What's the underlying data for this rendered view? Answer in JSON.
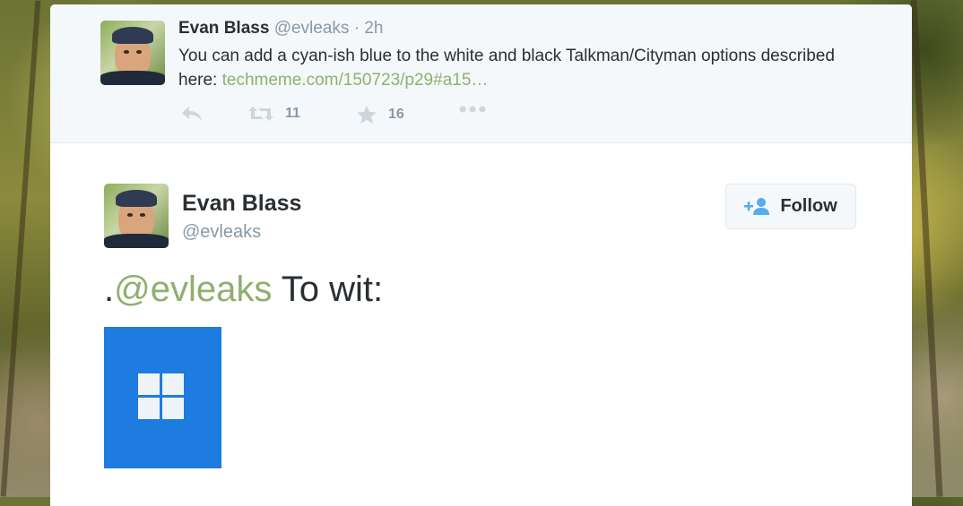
{
  "background": {
    "description_colors": [
      "#6b7434",
      "#c7b84d"
    ]
  },
  "previous_tweet": {
    "author_name": "Evan Blass",
    "author_handle": "@evleaks",
    "timestamp": "· 2h",
    "text_before_link": "You can add a cyan-ish blue to the white and black Talkman/Cityman options described here: ",
    "link_text": "techmeme.com/150723/p29#a15…",
    "actions": {
      "reply_icon": "reply-icon",
      "retweet_icon": "retweet-icon",
      "retweet_count": "11",
      "favorite_icon": "star-icon",
      "favorite_count": "16",
      "more_icon": "more-dots-icon"
    }
  },
  "tweet": {
    "author_name": "Evan Blass",
    "author_handle": "@evleaks",
    "follow_label": "Follow",
    "text_prefix": ".",
    "mention": "@evleaks",
    "text_suffix": " To wit:",
    "media_icon": "windows-logo-icon"
  },
  "colors": {
    "link": "#8faf6f",
    "text": "#292f33",
    "muted": "#8899a6",
    "media_blue": "#1e7be0"
  }
}
